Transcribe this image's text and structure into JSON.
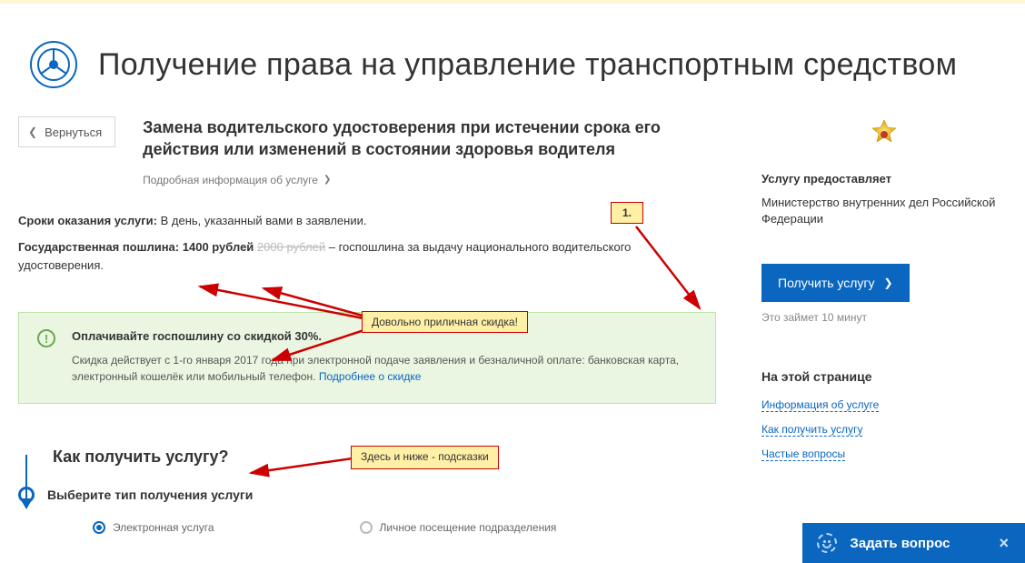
{
  "page": {
    "title": "Получение права на управление транспортным средством"
  },
  "back": {
    "label": "Вернуться"
  },
  "service": {
    "subtitle": "Замена водительского удостоверения при истечении срока его действия или изменений в состоянии здоровья водителя",
    "details_link": "Подробная информация об услуге"
  },
  "info": {
    "term_label": "Сроки оказания услуги:",
    "term_value": "В день, указанный вами в заявлении.",
    "fee_label": "Государственная пошлина:",
    "fee_price": "1400 рублей",
    "fee_old": "2000 рублей",
    "fee_desc": "– госпошлина за выдачу национального водительского удостоверения."
  },
  "discount_box": {
    "title": "Оплачивайте госпошлину со скидкой 30%.",
    "text": "Скидка действует с 1-го января 2017 года при электронной подаче заявления и безналичной оплате: банковская карта, электронный кошелёк или мобильный телефон.",
    "link": "Подробнее о скидке"
  },
  "how": {
    "title": "Как получить услугу?",
    "step1": "Выберите тип получения услуги",
    "option_a": "Электронная услуга",
    "option_b": "Личное посещение подразделения"
  },
  "right": {
    "provider_title": "Услугу предоставляет",
    "provider_name": "Министерство внутренних дел Российской Федерации",
    "button": "Получить услугу",
    "time": "Это займет 10 минут",
    "on_page": "На этой странице",
    "link1": "Информация об услуге",
    "link2": "Как получить услугу",
    "link3": "Частые вопросы"
  },
  "annotations": {
    "n1": "1.",
    "note_discount": "Довольно приличная скидка!",
    "note_hints": "Здесь и ниже - подсказки"
  },
  "ask": {
    "label": "Задать вопрос"
  }
}
